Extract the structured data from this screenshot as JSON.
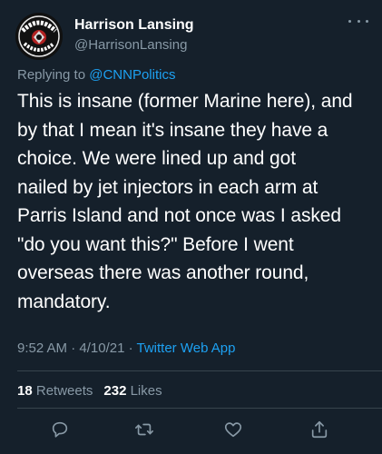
{
  "author": {
    "name": "Harrison Lansing",
    "handle": "@HarrisonLansing",
    "avatar_icon": "veteran-badge-avatar",
    "avatar_text": "VETERANS ... BORN ... MARINE"
  },
  "reply": {
    "prefix": "Replying to ",
    "mention": "@CNNPolitics"
  },
  "tweet": {
    "text": "This is insane (former Marine here), and\nby that I mean it's insane they have a\nchoice.  We were lined up and  got\nnailed by jet injectors in each arm at\nParris Island and not once was I asked\n\"do you want this?\" Before I went\noverseas there was another round,\nmandatory."
  },
  "meta": {
    "time": "9:52 AM",
    "separator": " · ",
    "date": "4/10/21",
    "separator2": " · ",
    "source": "Twitter Web App"
  },
  "stats": {
    "retweets_count": "18",
    "retweets_label": "Retweets",
    "likes_count": "232",
    "likes_label": "Likes"
  },
  "colors": {
    "background": "#15202b",
    "text": "#ffffff",
    "muted": "#8899a6",
    "accent": "#1da1f2",
    "divider": "#38444d"
  },
  "actions": [
    "reply-icon",
    "retweet-icon",
    "like-icon",
    "share-icon"
  ]
}
